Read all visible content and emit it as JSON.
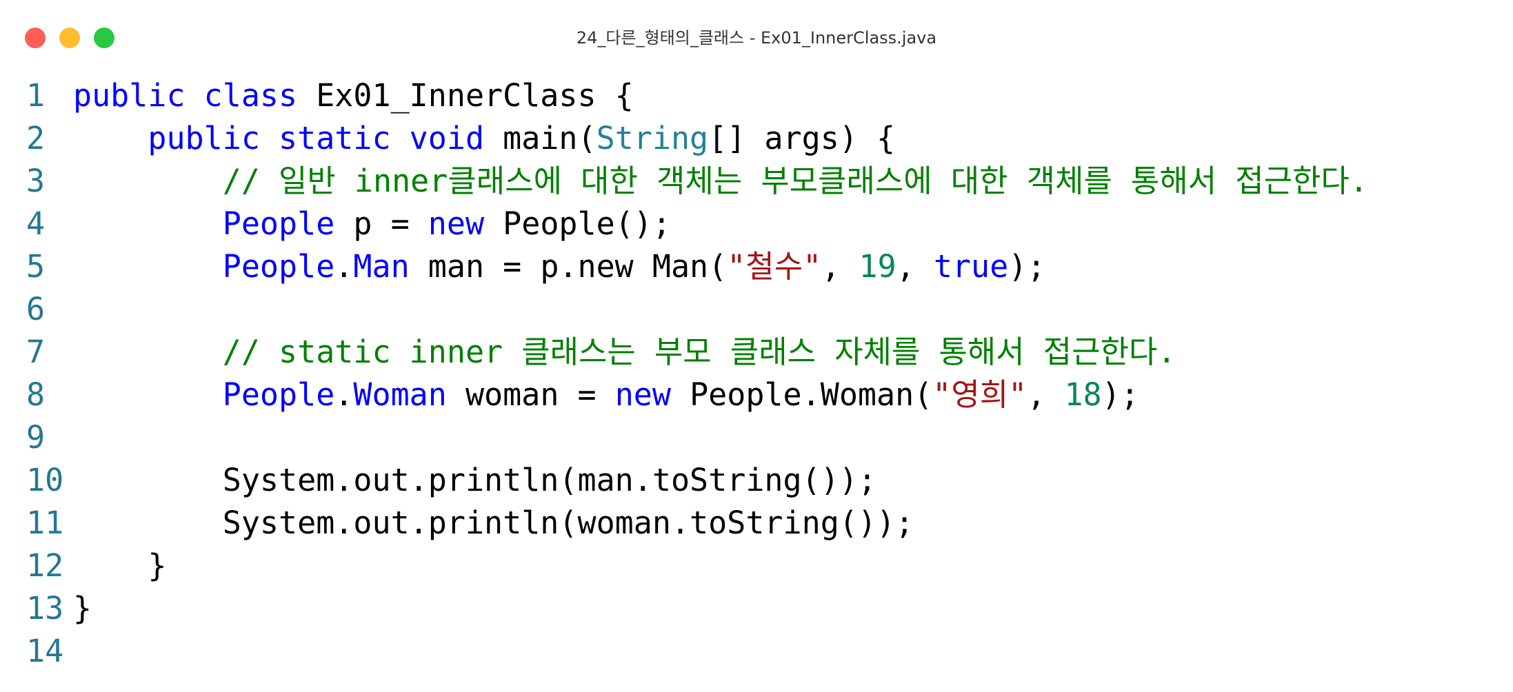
{
  "window": {
    "title": "24_다른_형태의_클래스 - Ex01_InnerClass.java",
    "traffic_lights": [
      {
        "name": "close",
        "color": "#ff5f57"
      },
      {
        "name": "minimize",
        "color": "#febc2e"
      },
      {
        "name": "maximize",
        "color": "#28c840"
      }
    ]
  },
  "colors": {
    "keyword": "#0000ff",
    "type": "#267f99",
    "string": "#a31515",
    "number": "#098658",
    "comment": "#008000",
    "line_number": "#237893",
    "text": "#000000"
  },
  "editor": {
    "lines": [
      {
        "number": "1",
        "tokens": [
          {
            "t": "public class",
            "k": "keyword"
          },
          {
            "t": " Ex01_InnerClass {",
            "k": "plain"
          }
        ]
      },
      {
        "number": "2",
        "tokens": [
          {
            "t": "    public static void",
            "k": "keyword"
          },
          {
            "t": " main(",
            "k": "plain"
          },
          {
            "t": "String",
            "k": "type"
          },
          {
            "t": "[] args) {",
            "k": "plain"
          }
        ]
      },
      {
        "number": "3",
        "tokens": [
          {
            "t": "        // 일반 inner클래스에 대한 객체는 부모클래스에 대한 객체를 통해서 접근한다.",
            "k": "comment"
          }
        ]
      },
      {
        "number": "4",
        "tokens": [
          {
            "t": "        People",
            "k": "class"
          },
          {
            "t": " p = ",
            "k": "plain"
          },
          {
            "t": "new",
            "k": "keyword"
          },
          {
            "t": " People();",
            "k": "plain"
          }
        ]
      },
      {
        "number": "5",
        "tokens": [
          {
            "t": "        People",
            "k": "class"
          },
          {
            "t": ".",
            "k": "plain"
          },
          {
            "t": "Man",
            "k": "class"
          },
          {
            "t": " man = p.new Man(",
            "k": "plain"
          },
          {
            "t": "\"철수\"",
            "k": "string"
          },
          {
            "t": ", ",
            "k": "plain"
          },
          {
            "t": "19",
            "k": "number"
          },
          {
            "t": ", ",
            "k": "plain"
          },
          {
            "t": "true",
            "k": "keyword"
          },
          {
            "t": ");",
            "k": "plain"
          }
        ]
      },
      {
        "number": "6",
        "tokens": []
      },
      {
        "number": "7",
        "tokens": [
          {
            "t": "        // static inner 클래스는 부모 클래스 자체를 통해서 접근한다.",
            "k": "comment"
          }
        ]
      },
      {
        "number": "8",
        "tokens": [
          {
            "t": "        People",
            "k": "class"
          },
          {
            "t": ".",
            "k": "plain"
          },
          {
            "t": "Woman",
            "k": "class"
          },
          {
            "t": " woman = ",
            "k": "plain"
          },
          {
            "t": "new",
            "k": "keyword"
          },
          {
            "t": " People.Woman(",
            "k": "plain"
          },
          {
            "t": "\"영희\"",
            "k": "string"
          },
          {
            "t": ", ",
            "k": "plain"
          },
          {
            "t": "18",
            "k": "number"
          },
          {
            "t": ");",
            "k": "plain"
          }
        ]
      },
      {
        "number": "9",
        "tokens": []
      },
      {
        "number": "10",
        "tokens": [
          {
            "t": "        System.out.println(man.toString());",
            "k": "plain"
          }
        ]
      },
      {
        "number": "11",
        "tokens": [
          {
            "t": "        System.out.println(woman.toString());",
            "k": "plain"
          }
        ]
      },
      {
        "number": "12",
        "tokens": [
          {
            "t": "    }",
            "k": "plain"
          }
        ]
      },
      {
        "number": "13",
        "tokens": [
          {
            "t": "}",
            "k": "plain"
          }
        ]
      },
      {
        "number": "14",
        "tokens": []
      }
    ]
  }
}
